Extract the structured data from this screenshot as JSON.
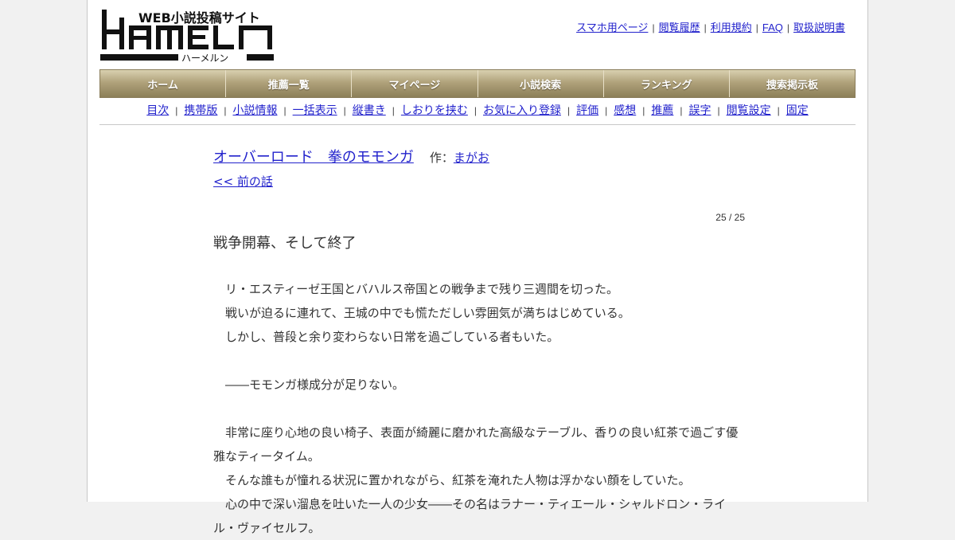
{
  "logo": {
    "wordmark": "HAMELN",
    "tagline": "WEB小説投稿サイト",
    "kana": "ハーメルン"
  },
  "header_links": [
    "スマホ用ページ",
    "閲覧履歴",
    "利用規約",
    "FAQ",
    "取扱説明書"
  ],
  "main_nav": [
    "ホーム",
    "推薦一覧",
    "マイページ",
    "小説検索",
    "ランキング",
    "捜索掲示板"
  ],
  "sub_nav": [
    "目次",
    "携帯版",
    "小説情報",
    "一括表示",
    "縦書き",
    "しおりを挟む",
    "お気に入り登録",
    "評価",
    "感想",
    "推薦",
    "誤字",
    "閲覧設定",
    "固定"
  ],
  "novel": {
    "title": "オーバーロード　拳のモモンガ",
    "author_prefix": "作：",
    "author": "まがお",
    "prev_link": "<< 前の話",
    "counter": "25 / 25",
    "chapter_title": "戦争開幕、そして終了",
    "paragraphs": [
      "　リ・エスティーゼ王国とバハルス帝国との戦争まで残り三週間を切った。",
      "　戦いが迫るに連れて、王城の中でも慌ただしい雰囲気が満ちはじめている。",
      "　しかし、普段と余り変わらない日常を過ごしている者もいた。",
      "",
      "　――モモンガ様成分が足りない。",
      "",
      "　非常に座り心地の良い椅子、表面が綺麗に磨かれた高級なテーブル、香りの良い紅茶で過ごす優雅なティータイム。",
      "　そんな誰もが憧れる状況に置かれながら、紅茶を淹れた人物は浮かない顔をしていた。",
      "　心の中で深い溜息を吐いた一人の少女――その名はラナー・ティエール・シャルドロン・ライル・ヴァイセルフ。"
    ]
  },
  "colors": {
    "link": "#2222cc",
    "nav_gold": "#b0a27b",
    "page_bg": "#f1f1f1"
  }
}
